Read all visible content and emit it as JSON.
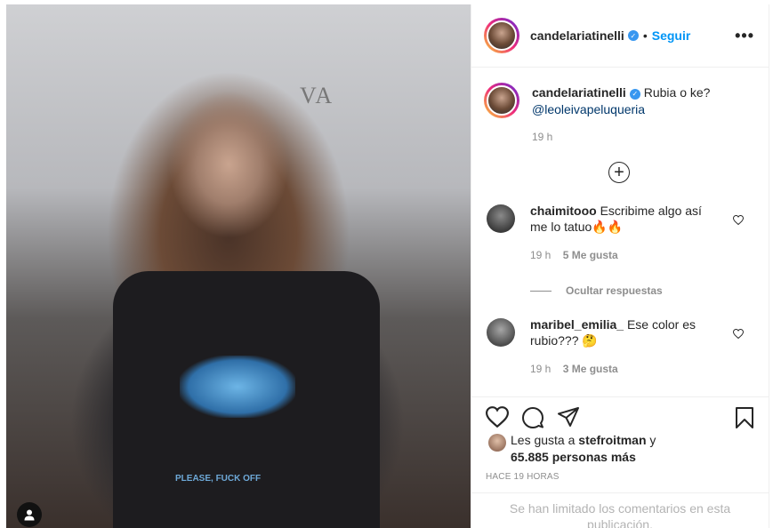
{
  "post": {
    "photo_wall_text": "VA",
    "shirt_text": "PLEASE, FUCK OFF"
  },
  "header": {
    "username": "candelariatinelli",
    "separator": "•",
    "follow_label": "Seguir",
    "more_label": "•••"
  },
  "caption": {
    "username": "candelariatinelli",
    "text": "Rubia o ke?",
    "mention": "@leoleivapeluqueria",
    "time": "19 h"
  },
  "load_more_label": "+",
  "comments": [
    {
      "username": "chaimitooo",
      "text": "Escribime algo así me lo tatuo🔥🔥",
      "time": "19 h",
      "likes": "5 Me gusta"
    },
    {
      "username": "maribel_emilia_",
      "text": "Ese color es rubio??? 🤔",
      "time": "19 h",
      "likes": "3 Me gusta"
    }
  ],
  "hide_replies_label": "Ocultar respuestas",
  "likes_summary": {
    "prefix": "Les gusta a",
    "user": "stefroitman",
    "connector": "y",
    "others": "65.885 personas más"
  },
  "post_time": "HACE 19 HORAS",
  "limited_notice": "Se han limitado los comentarios en esta publicación.",
  "colors": {
    "accent": "#0095f6",
    "text": "#262626",
    "muted": "#8e8e8e",
    "mention": "#00376b",
    "verified": "#3897f0",
    "border": "#efefef"
  },
  "icons": [
    "heart-icon",
    "comment-icon",
    "share-icon",
    "bookmark-icon",
    "verified-icon",
    "user-tag-icon",
    "plus-circle-icon"
  ]
}
